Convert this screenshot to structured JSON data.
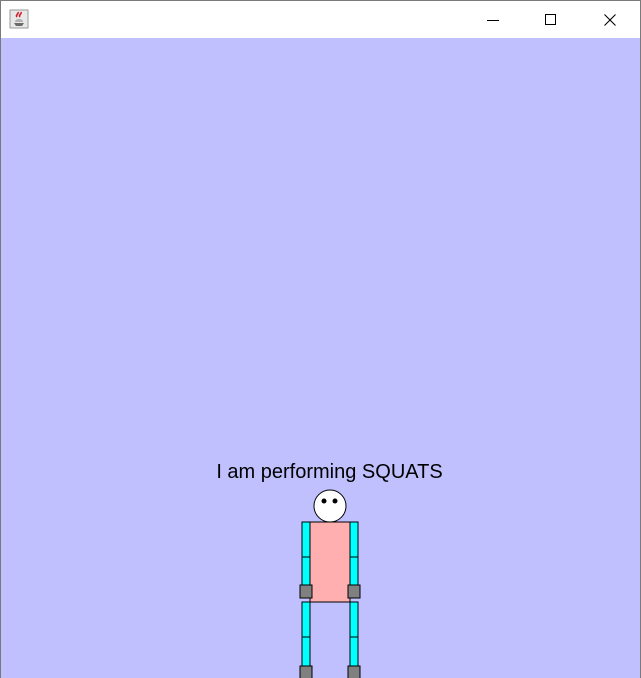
{
  "window": {
    "icon": "java-cup-icon",
    "controls": {
      "minimize": "minimize-icon",
      "maximize": "maximize-icon",
      "close": "close-icon"
    }
  },
  "scene": {
    "background_color": "#C0C0FF",
    "caption": "I am performing SQUATS",
    "exercise": "SQUATS",
    "figure": {
      "head_color": "#FFFFFF",
      "torso_color": "#FFAFAF",
      "limb_color": "#00FFFF",
      "joint_color": "#808080",
      "outline_color": "#000000"
    }
  }
}
